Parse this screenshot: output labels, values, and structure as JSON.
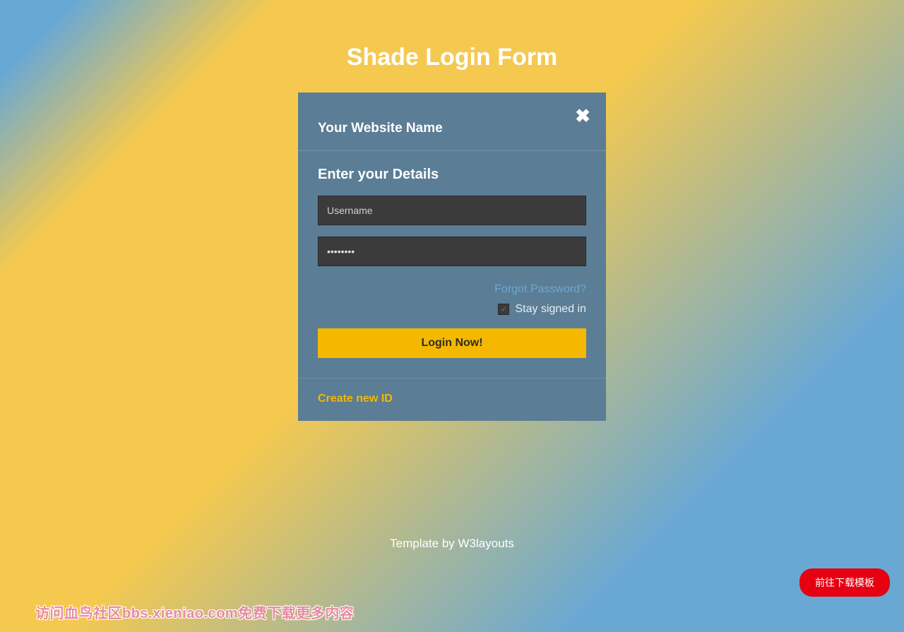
{
  "page": {
    "title": "Shade Login Form",
    "template_by": "Template by W3layouts"
  },
  "card": {
    "header_title": "Your Website Name",
    "close_label": "✖"
  },
  "form": {
    "subtitle": "Enter your Details",
    "username_placeholder": "Username",
    "password_value": "••••••••",
    "forgot_label": "Forgot Password?",
    "stay_label": "Stay signed in",
    "stay_checked": true,
    "login_button": "Login Now!"
  },
  "footer": {
    "create_label": "Create new ID"
  },
  "watermark": {
    "text": "访问血鸟社区bbs.xieniao.com免费下载更多内容"
  },
  "download_btn": {
    "label": "前往下载模板"
  },
  "colors": {
    "accent_yellow": "#f5b800",
    "card_bg": "#5b7d95",
    "input_bg": "#3b3b3b",
    "link_blue": "#6aa8d4",
    "danger_red": "#e60012"
  }
}
